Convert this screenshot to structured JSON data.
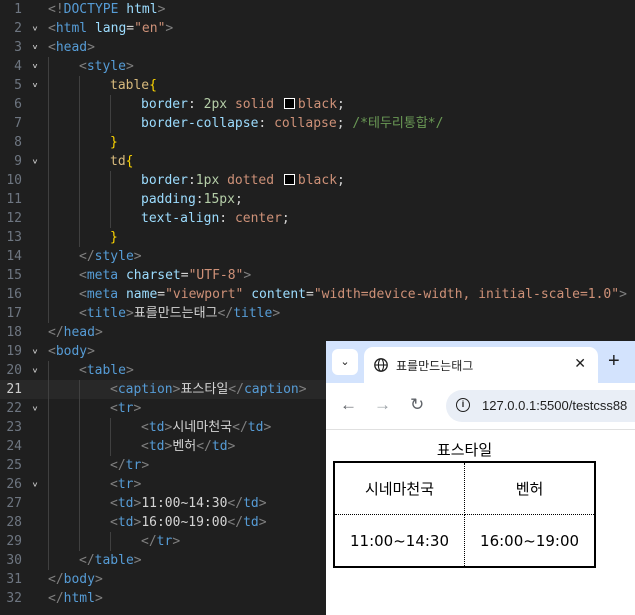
{
  "editor": {
    "lines": [
      {
        "n": "1",
        "fold": false,
        "indent": 0,
        "tokens": [
          [
            "t-br",
            "<!"
          ],
          [
            "t-tag",
            "DOCTYPE"
          ],
          [
            "t-txt",
            " "
          ],
          [
            "t-attr",
            "html"
          ],
          [
            "t-br",
            ">"
          ]
        ]
      },
      {
        "n": "2",
        "fold": true,
        "indent": 0,
        "tokens": [
          [
            "t-br",
            "<"
          ],
          [
            "t-tag",
            "html"
          ],
          [
            "t-txt",
            " "
          ],
          [
            "t-attr",
            "lang"
          ],
          [
            "t-txt",
            "="
          ],
          [
            "t-str",
            "\"en\""
          ],
          [
            "t-br",
            ">"
          ]
        ]
      },
      {
        "n": "3",
        "fold": true,
        "indent": 0,
        "tokens": [
          [
            "t-br",
            "<"
          ],
          [
            "t-tag",
            "head"
          ],
          [
            "t-br",
            ">"
          ]
        ]
      },
      {
        "n": "4",
        "fold": true,
        "indent": 1,
        "tokens": [
          [
            "t-br",
            "<"
          ],
          [
            "t-tag",
            "style"
          ],
          [
            "t-br",
            ">"
          ]
        ]
      },
      {
        "n": "5",
        "fold": true,
        "indent": 2,
        "tokens": [
          [
            "t-sel",
            "table"
          ],
          [
            "t-brace",
            "{"
          ]
        ]
      },
      {
        "n": "6",
        "fold": false,
        "indent": 3,
        "tokens": [
          [
            "t-prop",
            "border"
          ],
          [
            "t-txt",
            ": "
          ],
          [
            "t-num",
            "2px"
          ],
          [
            "t-txt",
            " "
          ],
          [
            "t-val",
            "solid"
          ],
          [
            "t-txt",
            " "
          ],
          [
            "swatch",
            ""
          ],
          [
            "t-val",
            "black"
          ],
          [
            "t-txt",
            ";"
          ]
        ]
      },
      {
        "n": "7",
        "fold": false,
        "indent": 3,
        "tokens": [
          [
            "t-prop",
            "border-collapse"
          ],
          [
            "t-txt",
            ": "
          ],
          [
            "t-val",
            "collapse"
          ],
          [
            "t-txt",
            "; "
          ],
          [
            "t-com",
            "/*테두리통합*/"
          ]
        ]
      },
      {
        "n": "8",
        "fold": false,
        "indent": 2,
        "tokens": [
          [
            "t-brace",
            "}"
          ]
        ]
      },
      {
        "n": "9",
        "fold": true,
        "indent": 2,
        "tokens": [
          [
            "t-sel",
            "td"
          ],
          [
            "t-brace",
            "{"
          ]
        ]
      },
      {
        "n": "10",
        "fold": false,
        "indent": 3,
        "tokens": [
          [
            "t-prop",
            "border"
          ],
          [
            "t-txt",
            ":"
          ],
          [
            "t-num",
            "1px"
          ],
          [
            "t-txt",
            " "
          ],
          [
            "t-val",
            "dotted"
          ],
          [
            "t-txt",
            " "
          ],
          [
            "swatch",
            ""
          ],
          [
            "t-val",
            "black"
          ],
          [
            "t-txt",
            ";"
          ]
        ]
      },
      {
        "n": "11",
        "fold": false,
        "indent": 3,
        "tokens": [
          [
            "t-prop",
            "padding"
          ],
          [
            "t-txt",
            ":"
          ],
          [
            "t-num",
            "15px"
          ],
          [
            "t-txt",
            ";"
          ]
        ]
      },
      {
        "n": "12",
        "fold": false,
        "indent": 3,
        "tokens": [
          [
            "t-prop",
            "text-align"
          ],
          [
            "t-txt",
            ": "
          ],
          [
            "t-val",
            "center"
          ],
          [
            "t-txt",
            ";"
          ]
        ]
      },
      {
        "n": "13",
        "fold": false,
        "indent": 2,
        "tokens": [
          [
            "t-brace",
            "}"
          ]
        ]
      },
      {
        "n": "14",
        "fold": false,
        "indent": 1,
        "tokens": [
          [
            "t-br",
            "</"
          ],
          [
            "t-tag",
            "style"
          ],
          [
            "t-br",
            ">"
          ]
        ]
      },
      {
        "n": "15",
        "fold": false,
        "indent": 1,
        "tokens": [
          [
            "t-br",
            "<"
          ],
          [
            "t-tag",
            "meta"
          ],
          [
            "t-txt",
            " "
          ],
          [
            "t-attr",
            "charset"
          ],
          [
            "t-txt",
            "="
          ],
          [
            "t-str",
            "\"UTF-8\""
          ],
          [
            "t-br",
            ">"
          ]
        ]
      },
      {
        "n": "16",
        "fold": false,
        "indent": 1,
        "tokens": [
          [
            "t-br",
            "<"
          ],
          [
            "t-tag",
            "meta"
          ],
          [
            "t-txt",
            " "
          ],
          [
            "t-attr",
            "name"
          ],
          [
            "t-txt",
            "="
          ],
          [
            "t-str",
            "\"viewport\""
          ],
          [
            "t-txt",
            " "
          ],
          [
            "t-attr",
            "content"
          ],
          [
            "t-txt",
            "="
          ],
          [
            "t-str",
            "\"width=device-width, initial-scale=1.0\""
          ],
          [
            "t-br",
            ">"
          ]
        ]
      },
      {
        "n": "17",
        "fold": false,
        "indent": 1,
        "tokens": [
          [
            "t-br",
            "<"
          ],
          [
            "t-tag",
            "title"
          ],
          [
            "t-br",
            ">"
          ],
          [
            "t-txt",
            "표를만드는태그"
          ],
          [
            "t-br",
            "</"
          ],
          [
            "t-tag",
            "title"
          ],
          [
            "t-br",
            ">"
          ]
        ]
      },
      {
        "n": "18",
        "fold": false,
        "indent": 0,
        "tokens": [
          [
            "t-br",
            "</"
          ],
          [
            "t-tag",
            "head"
          ],
          [
            "t-br",
            ">"
          ]
        ]
      },
      {
        "n": "19",
        "fold": true,
        "indent": 0,
        "tokens": [
          [
            "t-br",
            "<"
          ],
          [
            "t-tag",
            "body"
          ],
          [
            "t-br",
            ">"
          ]
        ]
      },
      {
        "n": "20",
        "fold": true,
        "indent": 1,
        "tokens": [
          [
            "t-br",
            "<"
          ],
          [
            "t-tag",
            "table"
          ],
          [
            "t-br",
            ">"
          ]
        ]
      },
      {
        "n": "21",
        "fold": false,
        "indent": 2,
        "active": true,
        "tokens": [
          [
            "t-br",
            "<"
          ],
          [
            "t-tag",
            "caption"
          ],
          [
            "t-br",
            ">"
          ],
          [
            "t-txt",
            "표스타일"
          ],
          [
            "t-br",
            "</"
          ],
          [
            "t-tag",
            "caption"
          ],
          [
            "t-br",
            ">"
          ]
        ]
      },
      {
        "n": "22",
        "fold": true,
        "indent": 2,
        "tokens": [
          [
            "t-br",
            "<"
          ],
          [
            "t-tag",
            "tr"
          ],
          [
            "t-br",
            ">"
          ]
        ]
      },
      {
        "n": "23",
        "fold": false,
        "indent": 3,
        "tokens": [
          [
            "t-br",
            "<"
          ],
          [
            "t-tag",
            "td"
          ],
          [
            "t-br",
            ">"
          ],
          [
            "t-txt",
            "시네마천국"
          ],
          [
            "t-br",
            "</"
          ],
          [
            "t-tag",
            "td"
          ],
          [
            "t-br",
            ">"
          ]
        ]
      },
      {
        "n": "24",
        "fold": false,
        "indent": 3,
        "tokens": [
          [
            "t-br",
            "<"
          ],
          [
            "t-tag",
            "td"
          ],
          [
            "t-br",
            ">"
          ],
          [
            "t-txt",
            "벤허"
          ],
          [
            "t-br",
            "</"
          ],
          [
            "t-tag",
            "td"
          ],
          [
            "t-br",
            ">"
          ]
        ]
      },
      {
        "n": "25",
        "fold": false,
        "indent": 2,
        "tokens": [
          [
            "t-br",
            "</"
          ],
          [
            "t-tag",
            "tr"
          ],
          [
            "t-br",
            ">"
          ]
        ]
      },
      {
        "n": "26",
        "fold": true,
        "indent": 2,
        "tokens": [
          [
            "t-br",
            "<"
          ],
          [
            "t-tag",
            "tr"
          ],
          [
            "t-br",
            ">"
          ]
        ]
      },
      {
        "n": "27",
        "fold": false,
        "indent": 2,
        "tokens": [
          [
            "t-br",
            "<"
          ],
          [
            "t-tag",
            "td"
          ],
          [
            "t-br",
            ">"
          ],
          [
            "t-txt",
            "11:00~14:30"
          ],
          [
            "t-br",
            "</"
          ],
          [
            "t-tag",
            "td"
          ],
          [
            "t-br",
            ">"
          ]
        ]
      },
      {
        "n": "28",
        "fold": false,
        "indent": 2,
        "tokens": [
          [
            "t-br",
            "<"
          ],
          [
            "t-tag",
            "td"
          ],
          [
            "t-br",
            ">"
          ],
          [
            "t-txt",
            "16:00~19:00"
          ],
          [
            "t-br",
            "</"
          ],
          [
            "t-tag",
            "td"
          ],
          [
            "t-br",
            ">"
          ]
        ]
      },
      {
        "n": "29",
        "fold": false,
        "indent": 3,
        "tokens": [
          [
            "t-br",
            "</"
          ],
          [
            "t-tag",
            "tr"
          ],
          [
            "t-br",
            ">"
          ]
        ]
      },
      {
        "n": "30",
        "fold": false,
        "indent": 1,
        "tokens": [
          [
            "t-br",
            "</"
          ],
          [
            "t-tag",
            "table"
          ],
          [
            "t-br",
            ">"
          ]
        ]
      },
      {
        "n": "31",
        "fold": false,
        "indent": 0,
        "tokens": [
          [
            "t-br",
            "</"
          ],
          [
            "t-tag",
            "body"
          ],
          [
            "t-br",
            ">"
          ]
        ]
      },
      {
        "n": "32",
        "fold": false,
        "indent": 0,
        "tokens": [
          [
            "t-br",
            "</"
          ],
          [
            "t-tag",
            "html"
          ],
          [
            "t-br",
            ">"
          ]
        ]
      }
    ]
  },
  "browser": {
    "tab_title": "표를만드는태그",
    "tab_close": "✕",
    "new_tab": "+",
    "tab_search": "⌄",
    "back": "←",
    "forward": "→",
    "reload": "↻",
    "url": "127.0.0.1:5500/testcss88",
    "table": {
      "caption": "표스타일",
      "rows": [
        [
          "시네마천국",
          "벤허"
        ],
        [
          "11:00~14:30",
          "16:00~19:00"
        ]
      ]
    }
  },
  "colors": {
    "editor_bg": "#1f1f1f",
    "tab_strip": "#d3e3fd",
    "omnibox": "#e9eef6"
  }
}
